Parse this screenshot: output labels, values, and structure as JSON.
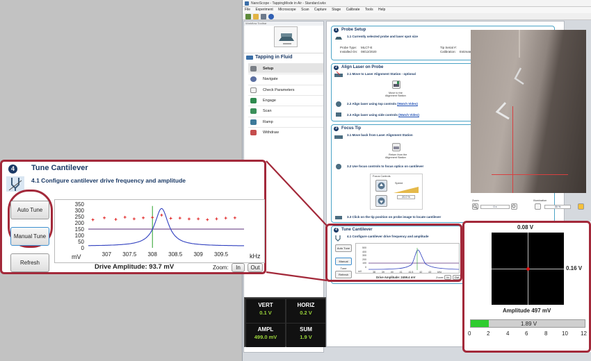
{
  "app": {
    "title": "NanoScope - TappingMode in Air - Standard.wkx",
    "menu": [
      "File",
      "Experiment",
      "Microscope",
      "Scan",
      "Capture",
      "Stage",
      "Calibrate",
      "Tools",
      "Help"
    ]
  },
  "workflow": {
    "toolbar_label": "Workflow Toolbar",
    "mode_title": "Tapping in Fluid",
    "steps": [
      "Setup",
      "Navigate",
      "Check Parameters",
      "Engage",
      "Scan",
      "Ramp",
      "Withdraw"
    ]
  },
  "probe_setup": {
    "number": "1",
    "title": "Probe Setup",
    "sub": "1.1 Currently selected probe and laser spot size",
    "probe_type_label": "Probe Type:",
    "probe_type": "MLCT-E",
    "tip_serial_label": "Tip Serial #:",
    "installed_label": "Installed On:",
    "installed": "08/12/2020",
    "calibration_label": "Calibration:",
    "calibration": "Estimated on 08/12/2020 at 16:04",
    "select_button": "Select Probe"
  },
  "align_laser": {
    "number": "2",
    "title": "Align Laser on Probe",
    "sub1": "2.1 Move to Laser Alignment Station - optional",
    "station_caption_1": "Move to the",
    "station_caption_2": "Alignment Station",
    "sub2": "2.2 Align laser using top controls",
    "sub3": "2.3 Align laser using side controls",
    "watch": "(Watch Video)"
  },
  "focus_tip": {
    "number": "3",
    "title": "Focus Tip",
    "sub1": "3.1 Move back from Laser Alignment Station",
    "return_caption_1": "Return from the",
    "return_caption_2": "Alignment Station",
    "sub2": "3.2 Use focus controls to focus optics on cantilever",
    "focus_controls": "Focus Controls",
    "speed": "Speed",
    "speed_value": "20.0 %",
    "sub3": "3.3 Click on the tip position on probe image to locate cantilever"
  },
  "tune_small": {
    "number": "4",
    "title": "Tune Cantilever",
    "sub": "4.1 Configure cantilever drive frequency and amplitude",
    "auto": "Auto Tune",
    "manual": "Manual Tune",
    "refresh": "Refresh",
    "drive": "Drive Amplitude: 2459.4 mV",
    "zoom": "Zoom:",
    "in": "In",
    "out": "Out",
    "yunit": "mV",
    "xunit": "kHz",
    "yticks": [
      "500",
      "400",
      "300",
      "200",
      "100",
      "0"
    ],
    "xticks": [
      "38",
      "39",
      "40",
      "41",
      "41.5",
      "42",
      "43"
    ]
  },
  "camera_controls": {
    "zoom_label": "Zoom",
    "zoom_value": "0 x",
    "illum_label": "Illumination",
    "illum_value": "30 %"
  },
  "quad": {
    "top_value": "0.08 V",
    "right_value": "0.16 V",
    "amplitude": "Amplitude 497 mV",
    "bar_value": "1.89 V",
    "bar_level": 0.157,
    "axis": [
      "0",
      "2",
      "4",
      "6",
      "8",
      "10",
      "12"
    ]
  },
  "meters": {
    "vert_label": "VERT",
    "vert_value": "0.1 V",
    "horiz_label": "HORIZ",
    "horiz_value": "0.2 V",
    "ampl_label": "AMPL",
    "ampl_value": "499.0 mV",
    "sum_label": "SUM",
    "sum_value": "1.9 V"
  },
  "tune_zoom": {
    "number": "4",
    "title": "Tune Cantilever",
    "sub": "4.1 Configure cantilever drive frequency and amplitude",
    "auto": "Auto Tune",
    "manual": "Manual Tune",
    "refresh": "Refresh",
    "drive": "Drive Amplitude: 93.7 mV",
    "zoom": "Zoom:",
    "in": "In",
    "out": "Out"
  },
  "chart_data": {
    "type": "line",
    "xlabel": "kHz",
    "ylabel": "mV",
    "xlim": [
      306.6,
      310.0
    ],
    "ylim": [
      0,
      350
    ],
    "xticks": [
      307,
      307.5,
      308,
      308.5,
      309,
      309.5
    ],
    "yticks": [
      0,
      50,
      100,
      150,
      200,
      250,
      300,
      350
    ],
    "resonance": {
      "center": 308.2,
      "peak": 315,
      "base": 14,
      "width": 0.18
    },
    "drive_line": 150,
    "marker_x": 308.0,
    "targets": {
      "x": [
        306.7,
        306.95,
        307.2,
        307.4,
        307.6,
        307.8,
        308.0,
        308.2,
        308.4,
        308.6,
        308.8,
        309.0,
        309.2,
        309.4,
        309.6,
        309.8
      ],
      "y": [
        225,
        240,
        228,
        245,
        232,
        240,
        243,
        262,
        236,
        238,
        231,
        232,
        226,
        232,
        238,
        240
      ]
    }
  }
}
